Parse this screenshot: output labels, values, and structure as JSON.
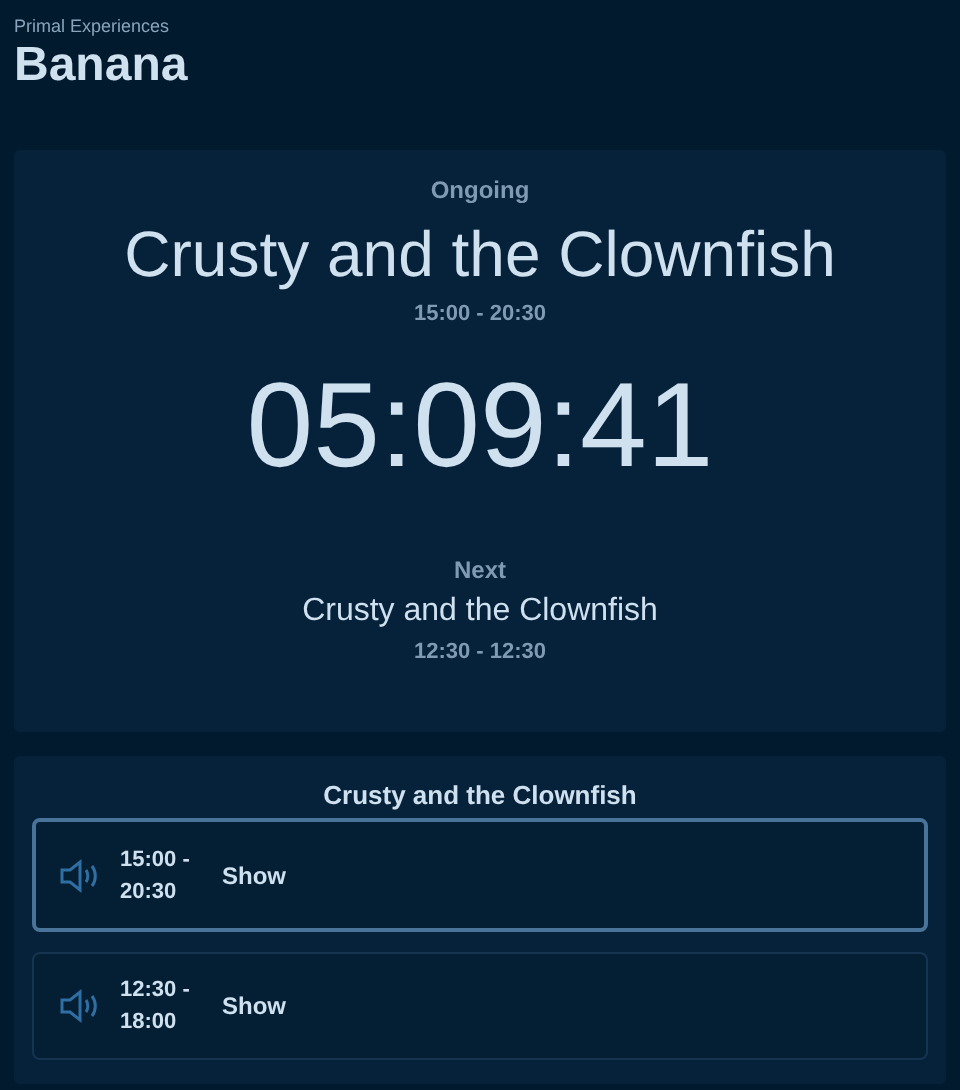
{
  "header": {
    "organization": "Primal Experiences",
    "title": "Banana"
  },
  "current": {
    "status": "Ongoing",
    "name": "Crusty and the Clownfish",
    "time": "15:00 - 20:30",
    "countdown": "05:09:41"
  },
  "next": {
    "label": "Next",
    "name": "Crusty and the Clownfish",
    "time": "12:30 - 12:30"
  },
  "schedule": {
    "title": "Crusty and the Clownfish",
    "items": [
      {
        "time": "15:00 - 20:30",
        "label": "Show",
        "selected": true
      },
      {
        "time": "12:30 - 18:00",
        "label": "Show",
        "selected": false
      }
    ]
  }
}
